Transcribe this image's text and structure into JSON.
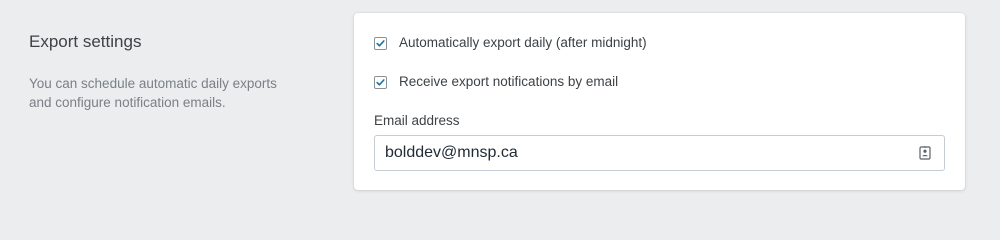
{
  "section": {
    "title": "Export settings",
    "description": "You can schedule automatic daily exports and configure notification emails."
  },
  "options": {
    "auto_export": {
      "label": "Automatically export daily (after midnight)",
      "checked": true
    },
    "email_notifications": {
      "label": "Receive export notifications by email",
      "checked": true
    }
  },
  "email_field": {
    "label": "Email address",
    "value": "bolddev@mnsp.ca",
    "icon": "contact-card-icon"
  },
  "colors": {
    "page_bg": "#ebedee",
    "card_bg": "#ffffff",
    "check_accent": "#1c6fa8"
  }
}
